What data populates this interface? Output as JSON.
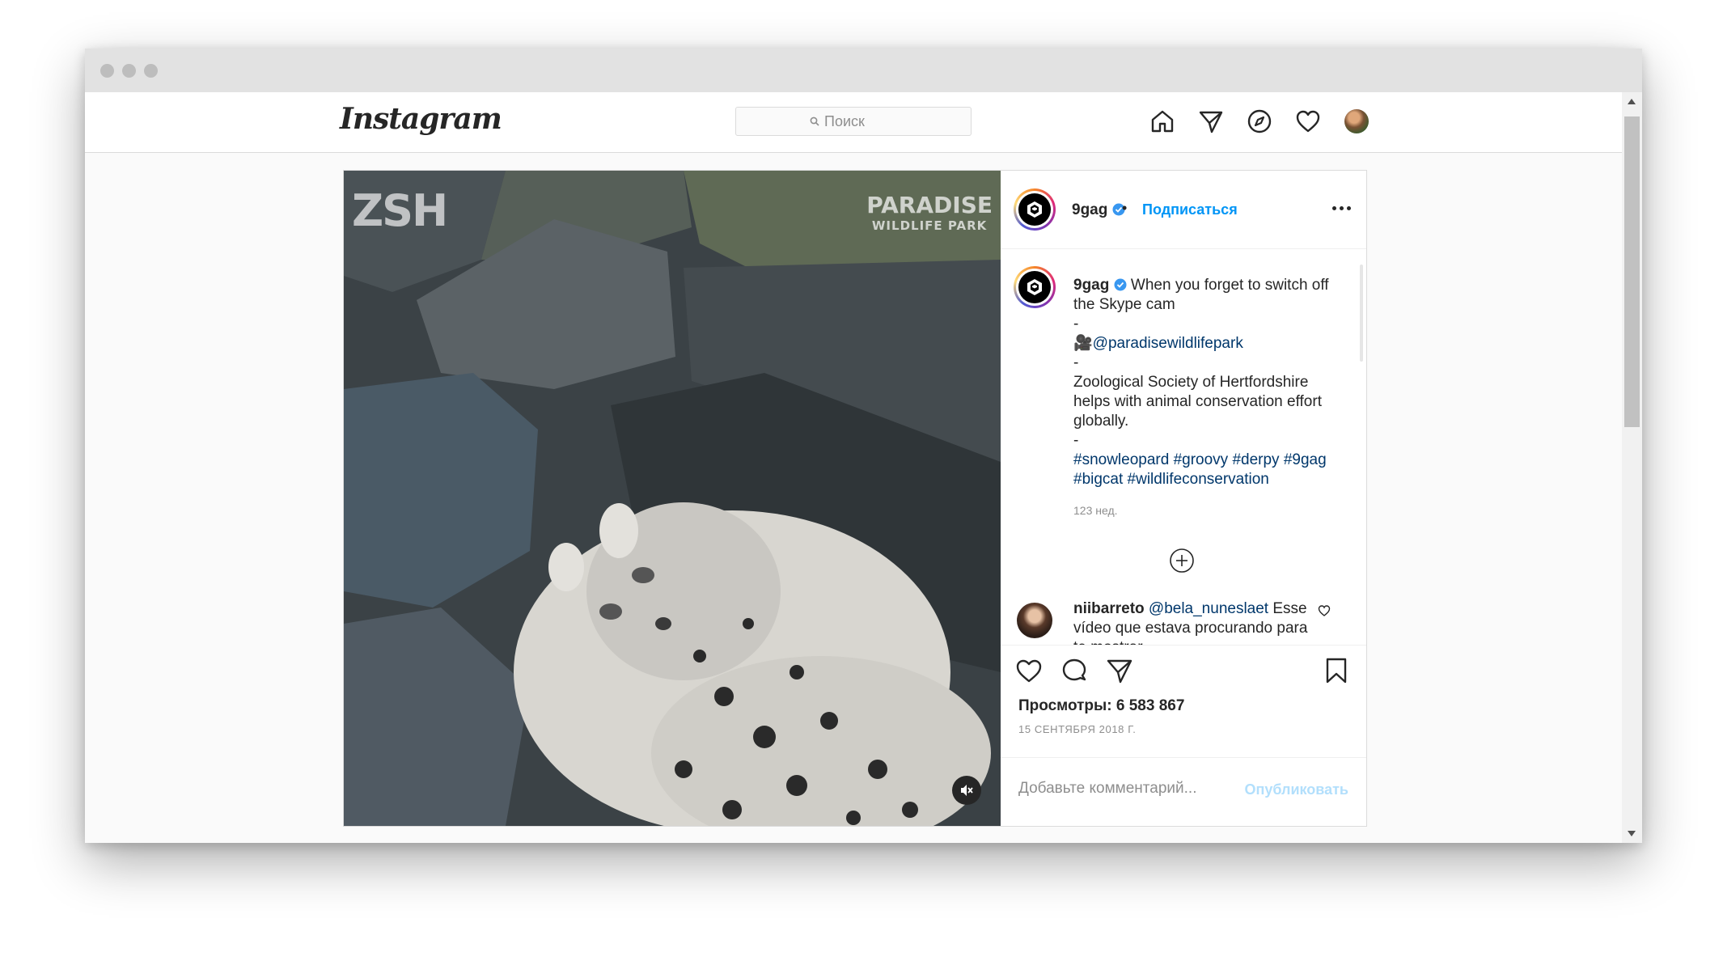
{
  "navbar": {
    "logo": "Instagram",
    "search_placeholder": "Поиск"
  },
  "nav_icons": [
    "home-icon",
    "direct-icon",
    "explore-icon",
    "activity-heart-icon",
    "profile-avatar"
  ],
  "media": {
    "watermark_left": "ZSH",
    "watermark_right_line1": "PARADISE",
    "watermark_right_line2": "WILDLIFE PARK"
  },
  "post_header": {
    "username": "9gag",
    "separator": "•",
    "follow": "Подписаться"
  },
  "caption": {
    "username": "9gag",
    "text_line1": "When you forget to switch off the Skype cam",
    "dash1": "-",
    "camera_emoji": "🎥",
    "mention": "@paradisewildlifepark",
    "dash2": "-",
    "text_line2": "Zoological Society of Hertfordshire helps with animal conservation effort globally.",
    "dash3": "-",
    "hashtags": "#snowleopard #groovy #derpy #9gag #bigcat #wildlifeconservation",
    "time": "123 нед."
  },
  "comments": [
    {
      "username": "niibarreto",
      "mention": "@bela_nuneslaet",
      "text": "Esse vídeo que estava procurando para te mostrar"
    }
  ],
  "stats": {
    "views": "Просмотры: 6 583 867",
    "date": "15 СЕНТЯБРЯ 2018 Г."
  },
  "add_comment": {
    "placeholder": "Добавьте комментарий...",
    "publish": "Опубликовать"
  },
  "colors": {
    "link_blue": "#0095f6",
    "link_dark": "#00376b",
    "publish_disabled": "#b2dffc",
    "border": "#dbdbdb"
  }
}
